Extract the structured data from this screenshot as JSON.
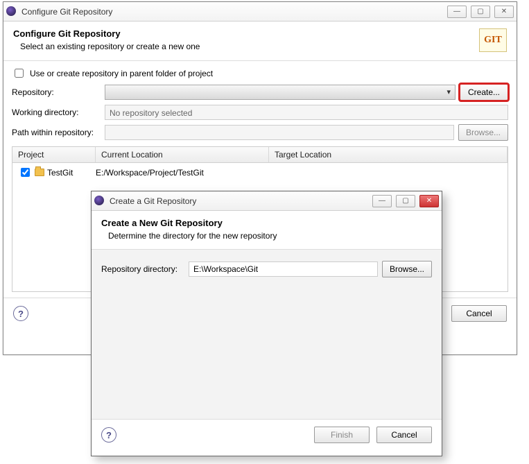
{
  "main": {
    "windowTitle": "Configure Git Repository",
    "headerTitle": "Configure Git Repository",
    "headerDesc": "Select an existing repository or create a new one",
    "gitLogo": "GIT",
    "useParentCheckboxLabel": "Use or create repository in parent folder of project",
    "repoLabel": "Repository:",
    "createBtn": "Create...",
    "workingDirLabel": "Working directory:",
    "workingDirValue": "No repository selected",
    "pathLabel": "Path within repository:",
    "browseBtn": "Browse...",
    "table": {
      "headers": {
        "project": "Project",
        "current": "Current Location",
        "target": "Target Location"
      },
      "rows": [
        {
          "checked": true,
          "project": "TestGit",
          "current": "E:/Workspace/Project/TestGit",
          "target": ""
        }
      ]
    },
    "cancelBtn": "Cancel"
  },
  "modal": {
    "windowTitle": "Create a Git Repository",
    "headerTitle": "Create a New Git Repository",
    "headerDesc": "Determine the directory for the new repository",
    "repoDirLabel": "Repository directory:",
    "repoDirValue": "E:\\Workspace\\Git",
    "browseBtn": "Browse...",
    "finishBtn": "Finish",
    "cancelBtn": "Cancel"
  }
}
